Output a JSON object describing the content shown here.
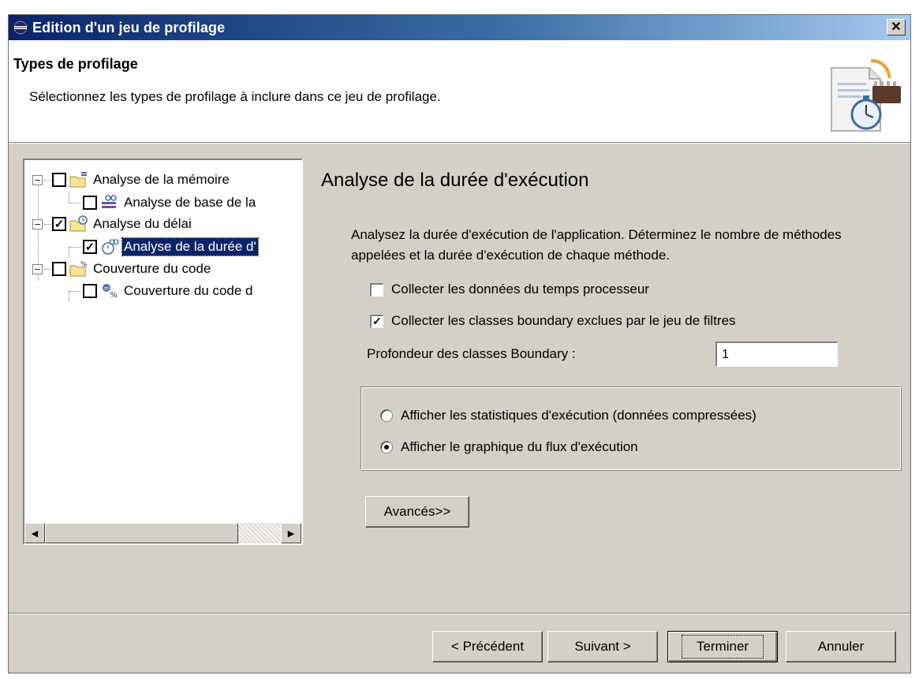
{
  "window": {
    "title": "Edition d'un jeu de profilage",
    "close_glyph": "✕"
  },
  "header": {
    "title": "Types de profilage",
    "description": "Sélectionnez les types de profilage à inclure dans ce jeu de profilage.",
    "image_icon": "profiling-wizard-banner-icon"
  },
  "tree": {
    "items": [
      {
        "label": "Analyse de la mémoire",
        "checked": false,
        "level": 0,
        "expanded": true,
        "icon": "memory-folder-icon"
      },
      {
        "label": "Analyse de base de la",
        "checked": false,
        "level": 1,
        "icon": "memory-analysis-icon"
      },
      {
        "label": "Analyse du délai",
        "checked": true,
        "level": 0,
        "expanded": true,
        "icon": "timing-folder-icon"
      },
      {
        "label": "Analyse de la durée d'",
        "checked": true,
        "level": 1,
        "selected": true,
        "icon": "execution-time-icon"
      },
      {
        "label": "Couverture du code",
        "checked": false,
        "level": 0,
        "expanded": true,
        "icon": "coverage-folder-icon"
      },
      {
        "label": "Couverture du code d",
        "checked": false,
        "level": 1,
        "icon": "code-coverage-icon"
      }
    ],
    "check_glyph": "✓",
    "expander_glyph": "−"
  },
  "detail": {
    "title": "Analyse de la durée d'exécution",
    "description": "Analysez la durée d'exécution de l'application. Déterminez le nombre de méthodes appelées et la durée d'exécution de chaque méthode.",
    "options": [
      {
        "label": "Collecter les données du temps processeur",
        "checked": false
      },
      {
        "label": "Collecter les classes boundary exclues par le jeu de filtres",
        "checked": true
      }
    ],
    "depth_label": "Profondeur des classes Boundary :",
    "depth_value": "1",
    "radios": [
      {
        "label": "Afficher les statistiques d'exécution (données compressées)",
        "selected": false
      },
      {
        "label": "Afficher le graphique du flux d'exécution",
        "selected": true
      }
    ],
    "advanced_button": "Avancés>>"
  },
  "footer": {
    "previous": "< Précédent",
    "next": "Suivant >",
    "finish": "Terminer",
    "cancel": "Annuler"
  }
}
